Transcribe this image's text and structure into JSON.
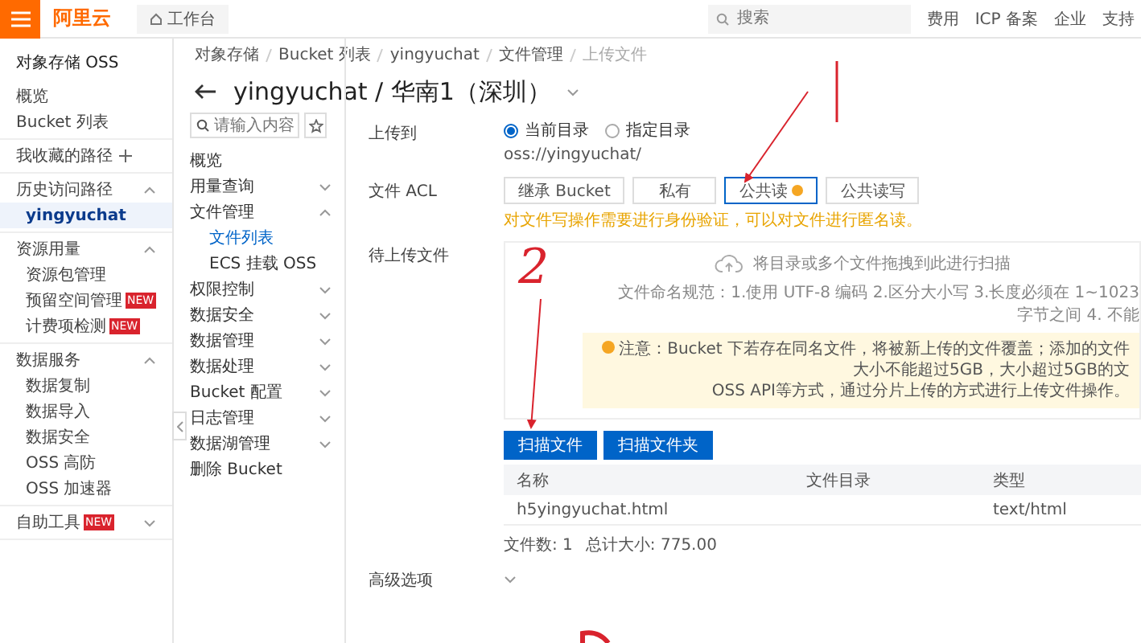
{
  "topbar": {
    "logo": "阿里云",
    "workbench": "工作台",
    "search": {
      "placeholder": "搜索"
    },
    "links": [
      "费用",
      "ICP 备案",
      "企业",
      "支持"
    ]
  },
  "sidebar": {
    "title": "对象存储 OSS",
    "sections": [
      {
        "kind": "links",
        "items": [
          {
            "label": "概览",
            "selected": false
          },
          {
            "label": "Bucket 列表",
            "selected": false
          }
        ]
      },
      {
        "kind": "add",
        "title": "我收藏的路径"
      },
      {
        "kind": "group",
        "title": "历史访问路径",
        "expanded": true,
        "items": [
          {
            "label": "yingyuchat",
            "selected": true
          }
        ]
      },
      {
        "kind": "group",
        "title": "资源用量",
        "expanded": true,
        "items": [
          {
            "label": "资源包管理",
            "selected": false
          },
          {
            "label": "预留空间管理",
            "badge": "NEW",
            "selected": false
          },
          {
            "label": "计费项检测",
            "badge": "NEW",
            "selected": false
          }
        ]
      },
      {
        "kind": "group",
        "title": "数据服务",
        "expanded": true,
        "items": [
          {
            "label": "数据复制",
            "selected": false
          },
          {
            "label": "数据导入",
            "selected": false
          },
          {
            "label": "数据安全",
            "selected": false
          },
          {
            "label": "OSS 高防",
            "selected": false
          },
          {
            "label": "OSS 加速器",
            "selected": false
          }
        ]
      },
      {
        "kind": "group",
        "title": "自助工具",
        "badge": "NEW",
        "expanded": false
      }
    ]
  },
  "breadcrumb": [
    "对象存储",
    "Bucket 列表",
    "yingyuchat",
    "文件管理",
    "上传文件"
  ],
  "title": "yingyuchat / 华南1（深圳）",
  "nav": {
    "search": {
      "placeholder": "请输入内容"
    },
    "items": [
      {
        "kind": "leaf",
        "label": "概览",
        "selected": false
      },
      {
        "kind": "group",
        "label": "用量查询",
        "expanded": false
      },
      {
        "kind": "group",
        "label": "文件管理",
        "expanded": true,
        "children": [
          {
            "label": "文件列表",
            "selected": true
          },
          {
            "label": "ECS 挂载 OSS",
            "selected": false
          }
        ]
      },
      {
        "kind": "group",
        "label": "权限控制",
        "expanded": false
      },
      {
        "kind": "group",
        "label": "数据安全",
        "expanded": false
      },
      {
        "kind": "group",
        "label": "数据管理",
        "expanded": false
      },
      {
        "kind": "group",
        "label": "数据处理",
        "expanded": false
      },
      {
        "kind": "group",
        "label": "Bucket 配置",
        "expanded": false
      },
      {
        "kind": "group",
        "label": "日志管理",
        "expanded": false
      },
      {
        "kind": "group",
        "label": "数据湖管理",
        "expanded": false
      },
      {
        "kind": "leaf",
        "label": "删除 Bucket",
        "selected": false
      }
    ]
  },
  "upload_to": {
    "label": "上传到",
    "options": [
      {
        "label": "当前目录",
        "selected": true
      },
      {
        "label": "指定目录",
        "selected": false
      }
    ],
    "path": "oss://yingyuchat/"
  },
  "acl": {
    "label": "文件 ACL",
    "options": [
      {
        "label": "继承 Bucket",
        "selected": false,
        "warn": false
      },
      {
        "label": "私有",
        "selected": false,
        "warn": false
      },
      {
        "label": "公共读",
        "selected": true,
        "warn": true
      },
      {
        "label": "公共读写",
        "selected": false,
        "warn": false
      }
    ],
    "hint": "对文件写操作需要进行身份验证，可以对文件进行匿名读。"
  },
  "files": {
    "label": "待上传文件",
    "drop_hint": "将目录或多个文件拖拽到此进行扫描",
    "naming_rule": "文件命名规范：1.使用 UTF-8 编码 2.区分大小写 3.长度必须在 1~1023 字节之间 4. 不能",
    "notice": [
      "注意：Bucket 下若存在同名文件，将被新上传的文件覆盖；添加的文件大小不能超过5GB，大小超过5GB的文",
      "OSS API等方式，通过分片上传的方式进行上传文件操作。"
    ],
    "buttons": [
      "扫描文件",
      "扫描文件夹"
    ],
    "table": {
      "columns": [
        "名称",
        "文件目录",
        "类型"
      ],
      "rows": [
        {
          "name": "h5yingyuchat.html",
          "type": "text/html"
        }
      ]
    },
    "summary": [
      "文件数: 1",
      "总计大小: 775.00"
    ]
  },
  "advanced": {
    "label": "高级选项",
    "expanded": false
  },
  "annotations": {
    "number": "2"
  }
}
